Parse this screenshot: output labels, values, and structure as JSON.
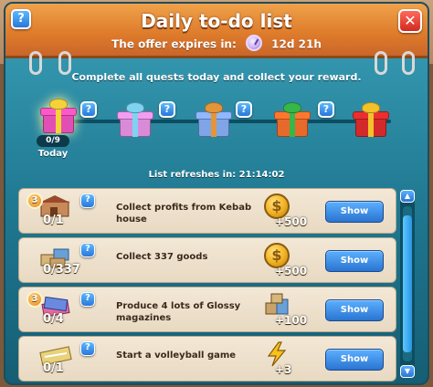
{
  "window": {
    "title": "Daily to-do list",
    "expires_label": "The offer expires in:",
    "expires_value": "12d 21h",
    "help_glyph": "?",
    "close_glyph": "✕"
  },
  "instructions": "Complete all quests today and collect your reward.",
  "rewards_track": {
    "progress_label": "0/9",
    "progress_fraction": 0,
    "today_label": "Today",
    "gifts": [
      {
        "name": "gift-icon-day1",
        "colors": {
          "box": "#e24fb4",
          "ribbon": "#f6d23a"
        }
      },
      {
        "name": "gift-icon-day2",
        "colors": {
          "box": "#d98bd8",
          "ribbon": "#7fd3f0"
        }
      },
      {
        "name": "gift-icon-day3",
        "colors": {
          "box": "#7fa4e8",
          "ribbon": "#e3953a"
        }
      },
      {
        "name": "gift-icon-day4",
        "colors": {
          "box": "#e86a2a",
          "ribbon": "#37b64a"
        }
      },
      {
        "name": "gift-icon-day5",
        "colors": {
          "box": "#d22a2a",
          "ribbon": "#f3c12a"
        }
      }
    ]
  },
  "refresh": {
    "label": "List refreshes in:",
    "time": "21:14:02"
  },
  "quests": [
    {
      "tier": "3",
      "icon": "kebab-house-icon",
      "count": "0/1",
      "text": "Collect profits from Kebab house",
      "reward_icon": "coin-icon",
      "reward": "+500",
      "button": "Show"
    },
    {
      "tier": "",
      "icon": "goods-icon",
      "count": "0/337",
      "text": "Collect 337 goods",
      "reward_icon": "coin-icon",
      "reward": "+500",
      "button": "Show"
    },
    {
      "tier": "3",
      "icon": "magazines-icon",
      "count": "0/4",
      "text": "Produce 4 lots of Glossy magazines",
      "reward_icon": "goods-crate-icon",
      "reward": "+100",
      "button": "Show"
    },
    {
      "tier": "",
      "icon": "volleyball-icon",
      "count": "0/1",
      "text": "Start a volleyball game",
      "reward_icon": "energy-bolt-icon",
      "reward": "+3",
      "button": "Show"
    }
  ],
  "scroll": {
    "up_glyph": "▲",
    "down_glyph": "▼",
    "position_fraction": 0.06,
    "visible_fraction": 0.88
  },
  "colors": {
    "panel_top": "#3aa0b8",
    "header_orange": "#dd7a2a",
    "button_blue": "#2a74d0",
    "card_cream": "#f3e8d6"
  }
}
